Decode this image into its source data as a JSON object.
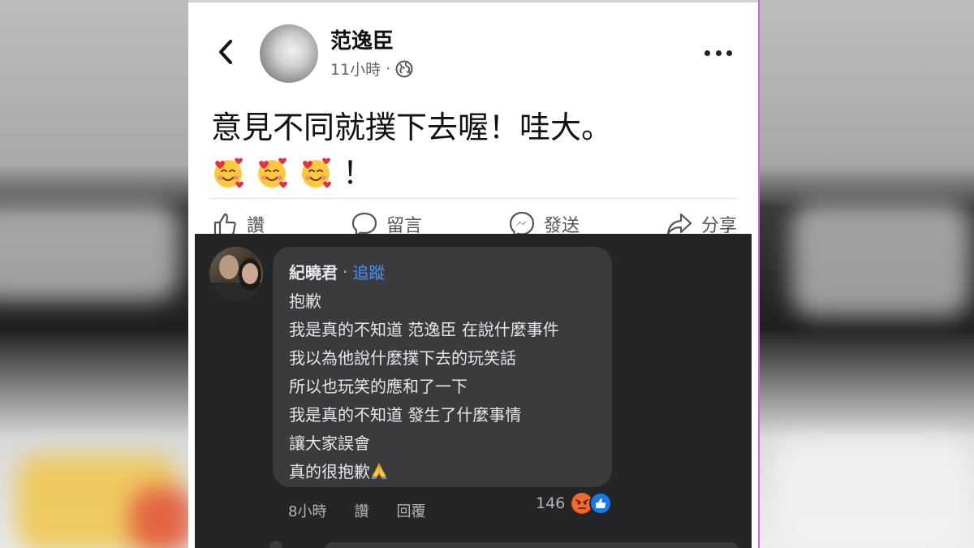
{
  "post": {
    "author": "范逸臣",
    "time": "11小時",
    "meta_separator": "·",
    "text_line1": "意見不同就撲下去喔！哇大。",
    "text_line2_suffix": "！",
    "emoji_icon": "smiling-face-with-hearts-icon",
    "actions": [
      {
        "label": "讚",
        "icon": "thumbs-up-icon"
      },
      {
        "label": "留言",
        "icon": "comment-icon"
      },
      {
        "label": "發送",
        "icon": "messenger-icon"
      },
      {
        "label": "分享",
        "icon": "share-icon"
      }
    ]
  },
  "comment": {
    "author": "紀曉君",
    "separator": "·",
    "follow_label": "追蹤",
    "lines": [
      "抱歉",
      "我是真的不知道 范逸臣 在說什麼事件",
      "我以為他說什麼撲下去的玩笑話",
      "所以也玩笑的應和了一下",
      "我是真的不知道 發生了什麼事情",
      "讓大家誤會",
      "真的很抱歉"
    ],
    "last_line_icon": "folded-hands-icon",
    "time": "8小時",
    "like_label": "讚",
    "reply_label": "回覆",
    "reaction_count": "146",
    "reaction_icons": [
      "angry-icon",
      "like-icon"
    ]
  },
  "colors": {
    "dark_bg": "#242526",
    "bubble_bg": "#3a3b3c",
    "link_blue": "#4f8ff7",
    "frame_border": "#c86ad8"
  }
}
